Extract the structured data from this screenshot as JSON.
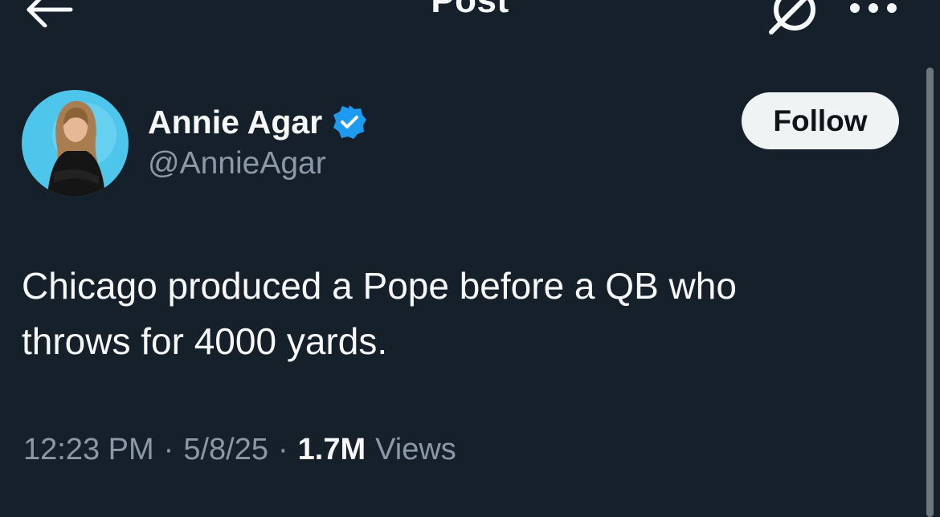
{
  "header": {
    "title": "Post"
  },
  "author": {
    "display_name": "Annie Agar",
    "handle": "@AnnieAgar",
    "follow_label": "Follow",
    "verified_color": "#1d9bf0"
  },
  "post": {
    "text_line1": "Chicago produced a Pope before a QB who",
    "text_line2": "throws for 4000 yards."
  },
  "meta": {
    "time": "12:23 PM",
    "separator": "·",
    "date": "5/8/25",
    "views_count": "1.7M",
    "views_label": "Views"
  },
  "colors": {
    "background": "#15202b",
    "primary_text": "#f7f9f9",
    "secondary_text": "#8b98a5",
    "accent": "#1d9bf0"
  }
}
